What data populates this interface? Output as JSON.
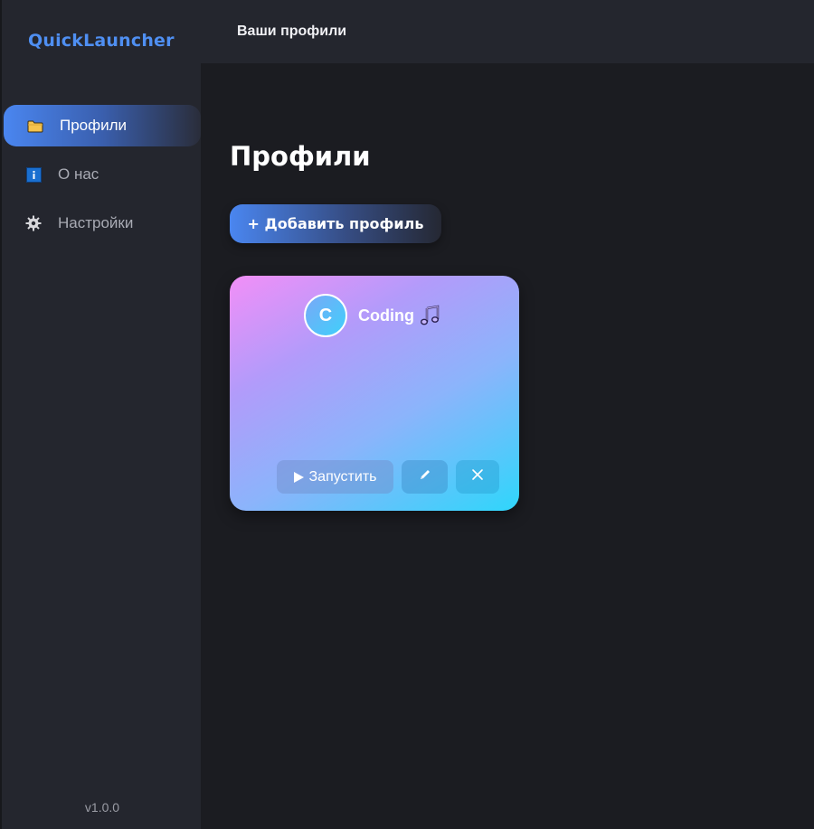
{
  "app": {
    "name": "QuickLauncher",
    "version": "v1.0.0"
  },
  "topbar": {
    "title": "Ваши профили"
  },
  "sidebar": {
    "items": [
      {
        "label": "Профили",
        "icon": "folder-icon",
        "active": true
      },
      {
        "label": "О нас",
        "icon": "info-icon",
        "active": false
      },
      {
        "label": "Настройки",
        "icon": "gear-icon",
        "active": false
      }
    ]
  },
  "main": {
    "title": "Профили",
    "add_button": "+ Добавить профиль",
    "profiles": [
      {
        "initial": "C",
        "name": "Coding",
        "emoji_icon": "music-notes-icon",
        "actions": {
          "launch": "Запустить",
          "edit_icon": "pencil-icon",
          "delete_icon": "close-icon"
        }
      }
    ]
  },
  "colors": {
    "accent": "#4f8ff2",
    "background": "#1b1c21",
    "sidebar": "#24262e",
    "card_gradient_start": "#f28ff8",
    "card_gradient_end": "#2fd6fb"
  }
}
